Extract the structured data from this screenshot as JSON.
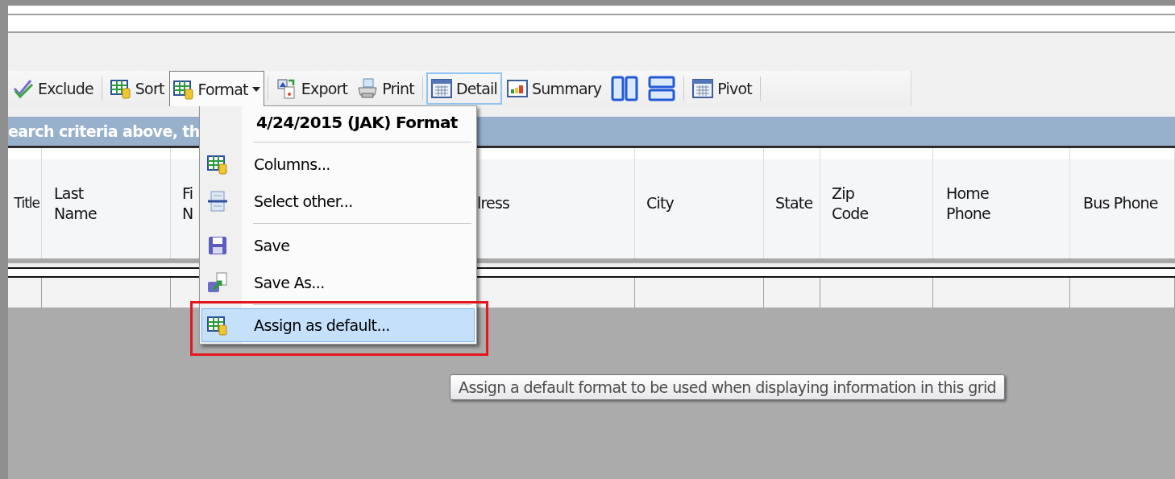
{
  "toolbar": [
    {
      "kind": "button",
      "label": "Exclude",
      "selected": false,
      "expanded": false
    },
    {
      "kind": "separator"
    },
    {
      "kind": "button",
      "label": "Sort",
      "selected": false,
      "expanded": false
    },
    {
      "kind": "dropdown",
      "label": "Format",
      "selected": false,
      "expanded": true
    },
    {
      "kind": "separator"
    },
    {
      "kind": "button",
      "label": "Export",
      "selected": false,
      "expanded": false
    },
    {
      "kind": "button",
      "label": "Print",
      "selected": false,
      "expanded": false
    },
    {
      "kind": "separator"
    },
    {
      "kind": "button",
      "label": "Detail",
      "selected": true,
      "expanded": false
    },
    {
      "kind": "button",
      "label": "Summary",
      "selected": false,
      "expanded": false
    },
    {
      "kind": "button",
      "selected": false,
      "expanded": false
    },
    {
      "kind": "button",
      "selected": false,
      "expanded": false
    },
    {
      "kind": "separator"
    },
    {
      "kind": "button",
      "label": "Pivot",
      "selected": false,
      "expanded": false
    },
    {
      "kind": "separator"
    }
  ],
  "info_bar": "earch  criteria above, th",
  "table": {
    "columns": [
      {
        "lines": [
          "Title"
        ]
      },
      {
        "lines": [
          "Last",
          "Name"
        ]
      },
      {
        "lines": [
          "Fi",
          "N"
        ]
      },
      {
        "lines": [
          "lress"
        ]
      },
      {
        "lines": [
          "City"
        ]
      },
      {
        "lines": [
          "State"
        ]
      },
      {
        "lines": [
          "Zip",
          "Code"
        ]
      },
      {
        "lines": [
          "Home",
          "Phone"
        ]
      },
      {
        "lines": [
          "Bus Phone"
        ]
      }
    ]
  },
  "format_menu": {
    "title": "4/24/2015 (JAK) Format",
    "items": [
      {
        "kind": "separator"
      },
      {
        "kind": "item",
        "label": "Columns...",
        "selected": false
      },
      {
        "kind": "item",
        "label": "Select other...",
        "selected": false
      },
      {
        "kind": "separator"
      },
      {
        "kind": "item",
        "label": "Save",
        "selected": false
      },
      {
        "kind": "item",
        "label": "Save As...",
        "selected": false
      },
      {
        "kind": "separator"
      },
      {
        "kind": "item",
        "label": "Assign as default...",
        "selected": true
      }
    ]
  },
  "tooltip": "Assign a default format to be used when displaying information in this grid"
}
